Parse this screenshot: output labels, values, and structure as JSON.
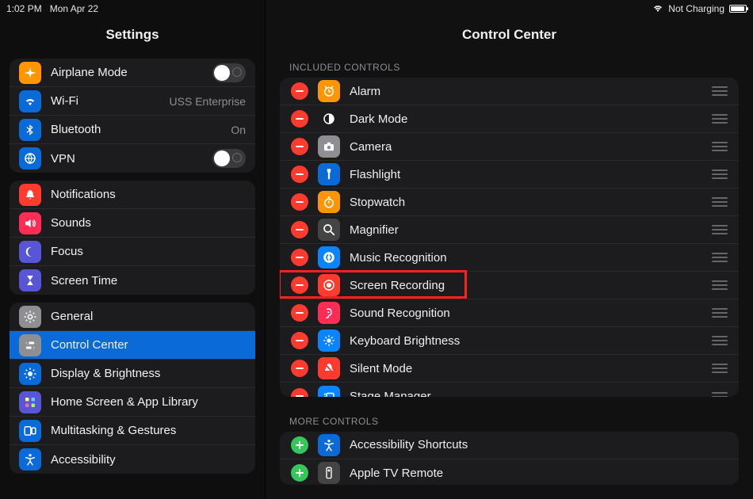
{
  "status": {
    "time": "1:02 PM",
    "date": "Mon Apr 22",
    "charging_text": "Not Charging"
  },
  "sidebar": {
    "title": "Settings",
    "groups": [
      [
        {
          "icon": "airplane",
          "bg": "#ff9500",
          "label": "Airplane Mode",
          "accessory": "toggle-off"
        },
        {
          "icon": "wifi",
          "bg": "#0a6ad8",
          "label": "Wi-Fi",
          "value": "USS Enterprise"
        },
        {
          "icon": "bluetooth",
          "bg": "#0a6ad8",
          "label": "Bluetooth",
          "value": "On"
        },
        {
          "icon": "vpn",
          "bg": "#0a6ad8",
          "label": "VPN",
          "accessory": "toggle-off"
        }
      ],
      [
        {
          "icon": "bell",
          "bg": "#ff3b30",
          "label": "Notifications"
        },
        {
          "icon": "speaker",
          "bg": "#ff2d55",
          "label": "Sounds"
        },
        {
          "icon": "moon",
          "bg": "#5856d6",
          "label": "Focus"
        },
        {
          "icon": "hourglass",
          "bg": "#5856d6",
          "label": "Screen Time"
        }
      ],
      [
        {
          "icon": "gear",
          "bg": "#8e8e93",
          "label": "General"
        },
        {
          "icon": "switches",
          "bg": "#8e8e93",
          "label": "Control Center",
          "selected": true
        },
        {
          "icon": "sun",
          "bg": "#0a6ad8",
          "label": "Display & Brightness"
        },
        {
          "icon": "apps",
          "bg": "#5856d6",
          "label": "Home Screen & App Library"
        },
        {
          "icon": "multitask",
          "bg": "#0a6ad8",
          "label": "Multitasking & Gestures"
        },
        {
          "icon": "accessibility",
          "bg": "#0a6ad8",
          "label": "Accessibility"
        }
      ]
    ]
  },
  "main": {
    "title": "Control Center",
    "included_header": "INCLUDED CONTROLS",
    "more_header": "MORE CONTROLS",
    "included": [
      {
        "icon": "alarm",
        "bg": "#ff9500",
        "label": "Alarm"
      },
      {
        "icon": "darkmode",
        "bg": "#1c1c1e",
        "label": "Dark Mode"
      },
      {
        "icon": "camera",
        "bg": "#8e8e93",
        "label": "Camera"
      },
      {
        "icon": "flashlight",
        "bg": "#0a6ad8",
        "label": "Flashlight"
      },
      {
        "icon": "stopwatch",
        "bg": "#ff9500",
        "label": "Stopwatch"
      },
      {
        "icon": "magnifier",
        "bg": "#444",
        "label": "Magnifier"
      },
      {
        "icon": "shazam",
        "bg": "#0a84ff",
        "label": "Music Recognition"
      },
      {
        "icon": "record",
        "bg": "#ff3b30",
        "label": "Screen Recording",
        "highlight": true
      },
      {
        "icon": "ear",
        "bg": "#ff2d55",
        "label": "Sound Recognition"
      },
      {
        "icon": "brightness",
        "bg": "#0a84ff",
        "label": "Keyboard Brightness"
      },
      {
        "icon": "silentbell",
        "bg": "#ff3b30",
        "label": "Silent Mode"
      },
      {
        "icon": "stage",
        "bg": "#0a84ff",
        "label": "Stage Manager"
      }
    ],
    "more": [
      {
        "icon": "accessibility",
        "bg": "#0a6ad8",
        "label": "Accessibility Shortcuts"
      },
      {
        "icon": "appletv",
        "bg": "#444",
        "label": "Apple TV Remote"
      }
    ]
  }
}
